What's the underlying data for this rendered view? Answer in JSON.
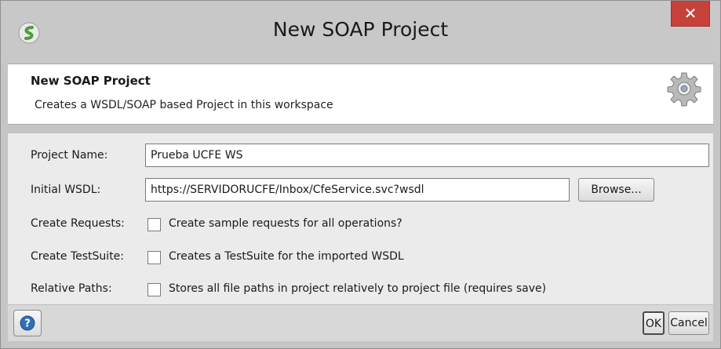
{
  "window": {
    "title": "New SOAP Project",
    "close_glyph": "✕",
    "logo_icon": "soapui-logo-icon"
  },
  "header": {
    "title": "New SOAP Project",
    "description": "Creates a WSDL/SOAP based Project in this workspace",
    "icon": "gear-icon"
  },
  "form": {
    "project_name": {
      "label": "Project Name:",
      "value": "Prueba UCFE WS"
    },
    "initial_wsdl": {
      "label": "Initial WSDL:",
      "value": "https://SERVIDORUCFE/Inbox/CfeService.svc?wsdl",
      "browse_label": "Browse..."
    },
    "create_requests": {
      "label": "Create Requests:",
      "option_text": "Create sample requests for all operations?",
      "checked": false
    },
    "create_testsuite": {
      "label": "Create TestSuite:",
      "option_text": "Creates a TestSuite for the imported WSDL",
      "checked": false
    },
    "relative_paths": {
      "label": "Relative Paths:",
      "option_text": "Stores all file paths in project relatively to project file (requires save)",
      "checked": false
    }
  },
  "footer": {
    "help_icon": "help-icon",
    "ok_label": "OK",
    "cancel_label": "Cancel"
  },
  "colors": {
    "close_button": "#c7413b",
    "help_icon_blue": "#2f6fb3",
    "logo_green": "#4e9a3a"
  }
}
